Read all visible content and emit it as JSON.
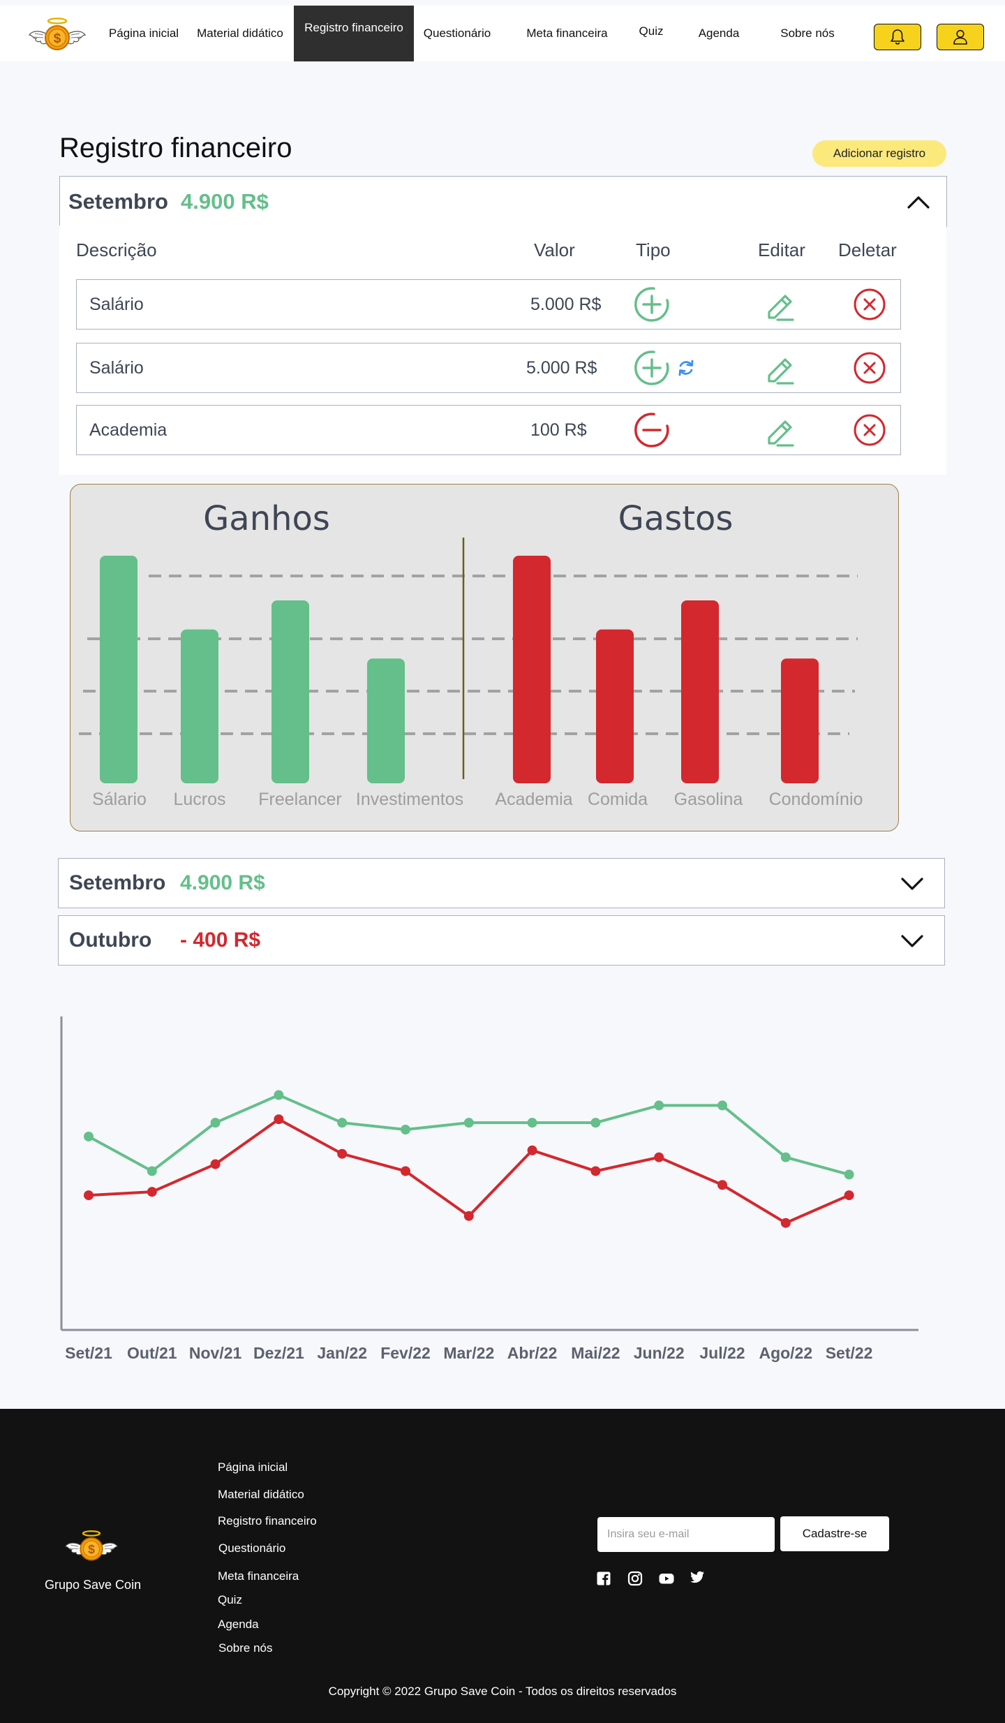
{
  "nav": {
    "items": [
      "Página inicial",
      "Material didático",
      "Registro financeiro",
      "Questionário",
      "Meta financeira",
      "Quiz",
      "Agenda",
      "Sobre nós"
    ],
    "active_index": 2,
    "icons": [
      "bell-icon",
      "user-icon"
    ]
  },
  "page": {
    "title": "Registro financeiro",
    "add_button": "Adicionar registro"
  },
  "records": {
    "open_month": "Setembro",
    "open_total": "4.900 R$",
    "headers": [
      "Descrição",
      "Valor",
      "Tipo",
      "Editar",
      "Deletar"
    ],
    "rows": [
      {
        "description": "Salário",
        "value": "5.000 R$",
        "type": "income",
        "recurring": false
      },
      {
        "description": "Salário",
        "value": "5.000 R$",
        "type": "income",
        "recurring": true
      },
      {
        "description": "Academia",
        "value": "100 R$",
        "type": "expense",
        "recurring": false
      }
    ],
    "months": [
      {
        "month": "Setembro",
        "total": "4.900 R$",
        "positive": true
      },
      {
        "month": "Outubro",
        "total": "- 400 R$",
        "positive": false
      }
    ]
  },
  "colors": {
    "income": "#64bf8a",
    "expense": "#d3282e",
    "text": "#3e4655",
    "accent_yellow": "#f6d21c",
    "recurring": "#3e8ef0"
  },
  "chart_data": [
    {
      "type": "bar",
      "grid": true,
      "groups": [
        {
          "title": "Ganhos",
          "categories": [
            "Sálario",
            "Lucros",
            "Freelancer",
            "Investimentos"
          ],
          "values": [
            100,
            67,
            80,
            54
          ]
        },
        {
          "title": "Gastos",
          "categories": [
            "Academia",
            "Comida",
            "Gasolina",
            "Condomínio"
          ],
          "values": [
            100,
            67,
            80,
            54
          ]
        }
      ]
    },
    {
      "type": "line",
      "grid": false,
      "x": [
        "Set/21",
        "Out/21",
        "Nov/21",
        "Dez/21",
        "Jan/22",
        "Fev/22",
        "Mar/22",
        "Abr/22",
        "Mai/22",
        "Jun/22",
        "Jul/22",
        "Ago/22",
        "Set/22"
      ],
      "ylim": [
        0,
        100
      ],
      "series": [
        {
          "color": "#64bf8a",
          "values": [
            59,
            49,
            63,
            71,
            63,
            61,
            63,
            63,
            63,
            68,
            68,
            53,
            48
          ]
        },
        {
          "color": "#d3282e",
          "values": [
            42,
            43,
            51,
            64,
            54,
            49,
            36,
            55,
            49,
            53,
            45,
            34,
            42
          ]
        }
      ]
    }
  ],
  "footer": {
    "brand": "Grupo Save Coin",
    "links": [
      "Página inicial",
      "Material didático",
      "Registro financeiro",
      "Questionário",
      "Meta financeira",
      "Quiz",
      "Agenda",
      "Sobre nós"
    ],
    "email_placeholder": "Insira seu e-mail",
    "submit": "Cadastre-se",
    "social": [
      "facebook-icon",
      "instagram-icon",
      "youtube-icon",
      "twitter-icon"
    ],
    "copyright": "Copyright © 2022 Grupo Save Coin - Todos os direitos reservados"
  }
}
